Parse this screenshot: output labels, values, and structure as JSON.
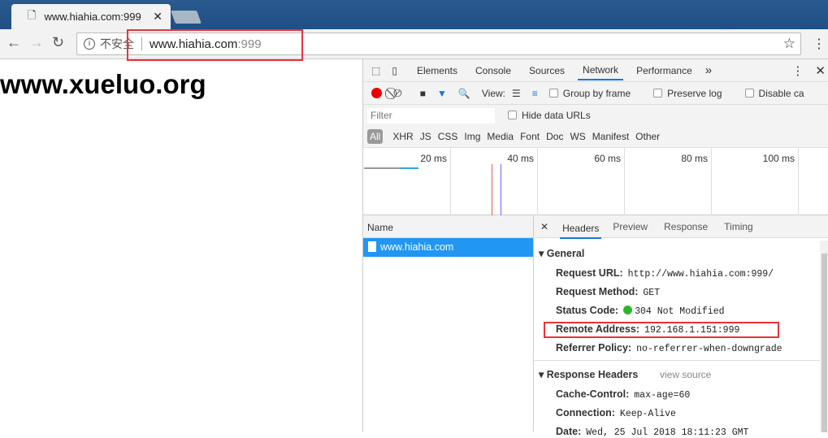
{
  "browser": {
    "tab_title": "www.hiahia.com:999",
    "security_label": "不安全",
    "url_host": "www.hiahia.com",
    "url_port": ":999"
  },
  "page": {
    "heading": "www.xueluo.org"
  },
  "devtools": {
    "tabs": [
      "Elements",
      "Console",
      "Sources",
      "Network",
      "Performance"
    ],
    "active_tab": "Network",
    "more": "»",
    "toolbar": {
      "view_label": "View:",
      "group_by_frame": "Group by frame",
      "preserve_log": "Preserve log",
      "disable_cache": "Disable ca"
    },
    "filter": {
      "placeholder": "Filter",
      "hide_data_urls": "Hide data URLs"
    },
    "types": [
      "All",
      "XHR",
      "JS",
      "CSS",
      "Img",
      "Media",
      "Font",
      "Doc",
      "WS",
      "Manifest",
      "Other"
    ],
    "timeline_ticks": [
      "20 ms",
      "40 ms",
      "60 ms",
      "80 ms",
      "100 ms"
    ],
    "name_header": "Name",
    "requests": [
      "www.hiahia.com"
    ],
    "detail_tabs": [
      "Headers",
      "Preview",
      "Response",
      "Timing"
    ],
    "general": {
      "title": "General",
      "rows": [
        {
          "k": "Request URL:",
          "v": "http://www.hiahia.com:999/"
        },
        {
          "k": "Request Method:",
          "v": "GET"
        },
        {
          "k": "Status Code:",
          "v": "304 Not Modified"
        },
        {
          "k": "Remote Address:",
          "v": "192.168.1.151:999"
        },
        {
          "k": "Referrer Policy:",
          "v": "no-referrer-when-downgrade"
        }
      ]
    },
    "response_headers": {
      "title": "Response Headers",
      "view_source": "view source",
      "rows": [
        {
          "k": "Cache-Control:",
          "v": "max-age=60"
        },
        {
          "k": "Connection:",
          "v": "Keep-Alive"
        },
        {
          "k": "Date:",
          "v": "Wed, 25 Jul 2018 18:11:23 GMT"
        }
      ]
    },
    "colors": {
      "status_ok": "#2db52d",
      "selected_row": "#2196f3",
      "highlight": "#e8333a"
    }
  }
}
